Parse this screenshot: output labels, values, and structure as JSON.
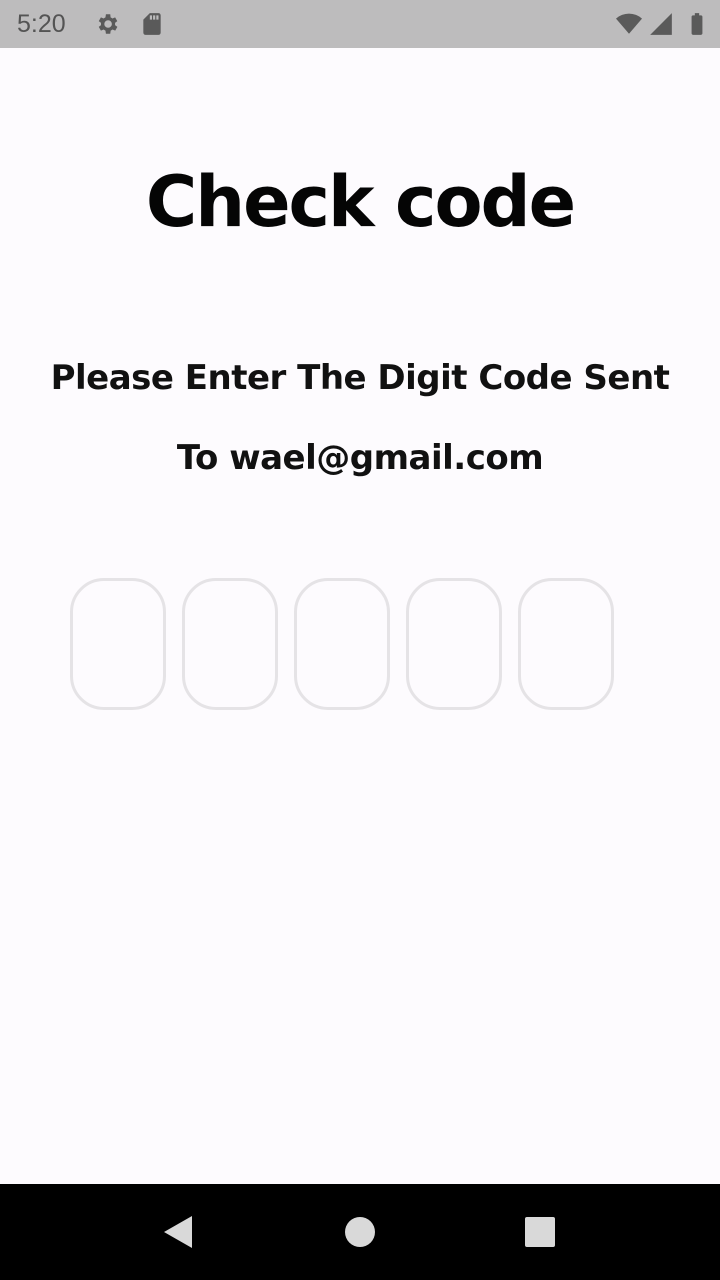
{
  "status_bar": {
    "time": "5:20",
    "icons": [
      "gear-icon",
      "sd-card-icon",
      "wifi-icon",
      "signal-icon",
      "battery-icon"
    ],
    "background": "#bdbcbd"
  },
  "page": {
    "title": "Check code",
    "subtitle_line1": "Please Enter The Digit Code Sent",
    "subtitle_line2": "To wael@gmail.com",
    "background": "#fdfbfe"
  },
  "code_inputs": {
    "count": 5,
    "values": [
      "",
      "",
      "",
      "",
      ""
    ],
    "border_color": "#e5e3e6"
  },
  "nav_bar": {
    "buttons": [
      "back-icon",
      "home-icon",
      "recents-icon"
    ],
    "background": "#000000"
  }
}
